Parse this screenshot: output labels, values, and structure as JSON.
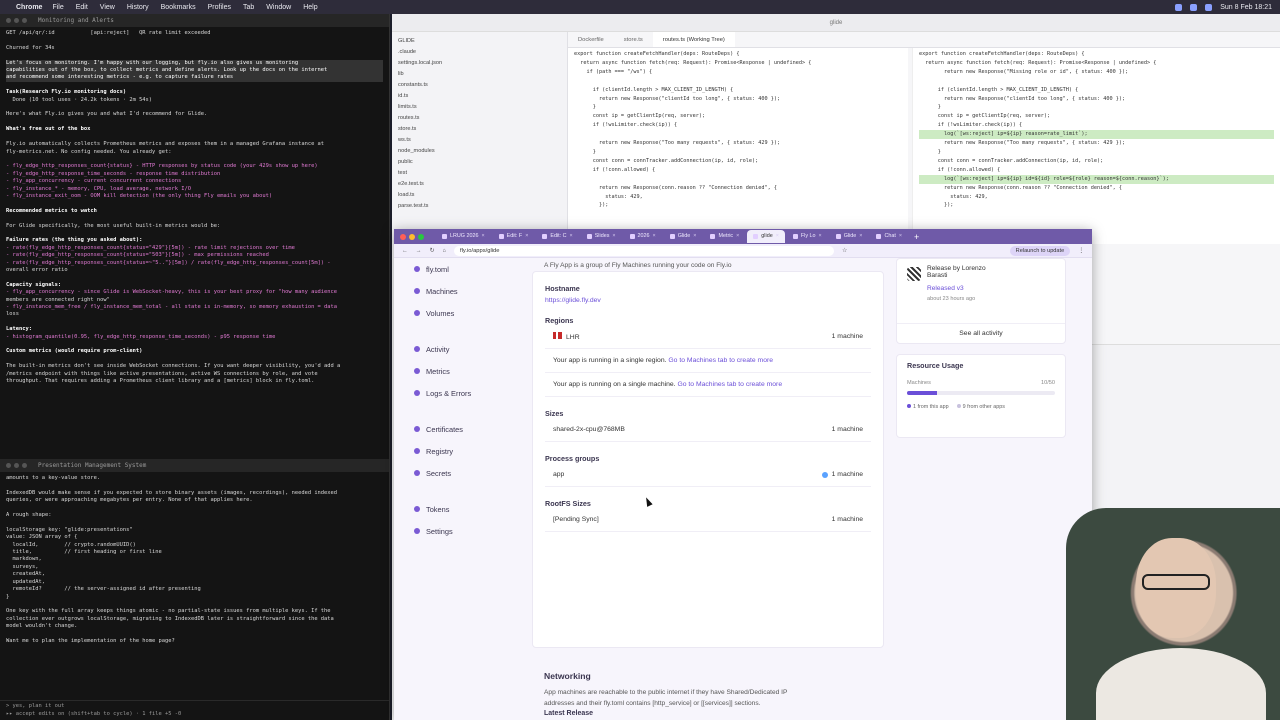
{
  "menubar": {
    "app": "Chrome",
    "items": [
      "File",
      "Edit",
      "View",
      "History",
      "Bookmarks",
      "Profiles",
      "Tab",
      "Window",
      "Help"
    ],
    "clock": "Sun 8 Feb 18:21"
  },
  "terminal_top": {
    "title": "Monitoring and Alerts",
    "lines": [
      "GET /api/qr/:id           [api:reject]   QR rate limit exceeded",
      "",
      "Churned for 34s",
      "",
      "Let's focus on monitoring. I'm happy with our logging, but fly.io also gives us monitoring",
      "capabilities out of the box, to collect metrics and define alerts. Look up the docs on the internet",
      "and recommend some interesting metrics - e.g. to capture failure rates",
      "",
      "Task(Research Fly.io monitoring docs)",
      "  Done (10 tool uses · 24.2k tokens · 2m 54s)",
      "",
      "Here's what Fly.io gives you and what I'd recommend for Glide.",
      "",
      "What's free out of the box",
      "",
      "Fly.io automatically collects Prometheus metrics and exposes them in a managed Grafana instance at",
      "fly-metrics.net. No config needed. You already get:",
      "",
      "- fly_edge_http_responses_count{status} - HTTP responses by status code (your 429s show up here)",
      "- fly_edge_http_response_time_seconds - response time distribution",
      "- fly_app_concurrency - current concurrent connections",
      "- fly_instance_* - memory, CPU, load average, network I/O",
      "- fly_instance_exit_oom - OOM kill detection (the only thing Fly emails you about)",
      "",
      "Recommended metrics to watch",
      "",
      "For Glide specifically, the most useful built-in metrics would be:",
      "",
      "Failure rates (the thing you asked about):",
      "- rate(fly_edge_http_responses_count{status=\"429\"}[5m]) - rate limit rejections over time",
      "- rate(fly_edge_http_responses_count{status=\"503\"}[5m]) - max permissions reached",
      "- rate(fly_edge_http_responses_count{status=~\"5..\"}[5m]) / rate(fly_edge_http_responses_count[5m]) -",
      "overall error ratio",
      "",
      "Capacity signals:",
      "- fly_app_concurrency - since Glide is WebSocket-heavy, this is your best proxy for \"how many audience",
      "members are connected right now\"",
      "- fly_instance_mem_free / fly_instance_mem_total - all state is in-memory, so memory exhaustion = data",
      "loss",
      "",
      "Latency:",
      "- histogram_quantile(0.95, fly_edge_http_response_time_seconds) - p95 response time",
      "",
      "Custom metrics (would require prom-client)",
      "",
      "The built-in metrics don't see inside WebSocket connections. If you want deeper visibility, you'd add a",
      "/metrics endpoint with things like active presentations, active WS connections by role, and vote",
      "throughput. That requires adding a Prometheus client library and a [metrics] block in fly.toml."
    ]
  },
  "terminal_bottom": {
    "title": "Presentation Management System",
    "lines": [
      "amounts to a key-value store.",
      "",
      "IndexedDB would make sense if you expected to store binary assets (images, recordings), needed indexed",
      "queries, or were approaching megabytes per entry. None of that applies here.",
      "",
      "A rough shape:",
      "",
      "localStorage key: \"glide:presentations\"",
      "value: JSON array of {",
      "  localId,        // crypto.randomUUID()",
      "  title,          // first heading or first line",
      "  markdown,",
      "  surveys,",
      "  createdAt,",
      "  updatedAt,",
      "  remoteId?       // the server-assigned id after presenting",
      "}",
      "",
      "One key with the full array keeps things atomic - no partial-state issues from multiple keys. If the",
      "collection ever outgrows localStorage, migrating to IndexedDB later is straightforward since the data",
      "model wouldn't change.",
      "",
      "Want me to plan the implementation of the home page?"
    ],
    "input": "> yes, plan it out",
    "footer": "▸▸ accept edits on (shift+tab to cycle) · 1 file +5 -0"
  },
  "vscode": {
    "title": "glide",
    "explorer": [
      "GLIDE",
      ".claude",
      "settings.local.json",
      "lib",
      "constants.ts",
      "id.ts",
      "limits.ts",
      "routes.ts",
      "store.ts",
      "ws.ts",
      "node_modules",
      "public",
      "test",
      "e2e.test.ts",
      "load.ts",
      "parse.test.ts"
    ],
    "tabs": [
      "Dockerfile",
      "store.ts",
      "routes.ts (Working Tree)"
    ],
    "left_code": [
      "export function createFetchHandler(deps: RouteDeps) {",
      "  return async function fetch(req: Request): Promise<Response | undefined> {",
      "    if (path === \"/ws\") {",
      "",
      "      if (clientId.length > MAX_CLIENT_ID_LENGTH) {",
      "        return new Response(\"clientId too long\", { status: 400 });",
      "      }",
      "      const ip = getClientIp(req, server);",
      "      if (!wsLimiter.check(ip)) {",
      "",
      "        return new Response(\"Too many requests\", { status: 429 });",
      "      }",
      "      const conn = connTracker.addConnection(ip, id, role);",
      "      if (!conn.allowed) {",
      "",
      "        return new Response(conn.reason ?? \"Connection denied\", {",
      "          status: 429,",
      "        });"
    ],
    "right_code": [
      "export function createFetchHandler(deps: RouteDeps) {",
      "  return async function fetch(req: Request): Promise<Response | undefined> {",
      "        return new Response(\"Missing role or id\", { status: 400 });",
      "",
      "      if (clientId.length > MAX_CLIENT_ID_LENGTH) {",
      "        return new Response(\"clientId too long\", { status: 400 });",
      "      }",
      "      const ip = getClientIp(req, server);",
      "      if (!wsLimiter.check(ip)) {",
      "        log(`[ws:reject] ip=${ip} reason=rate_limit`);",
      "        return new Response(\"Too many requests\", { status: 429 });",
      "      }",
      "      const conn = connTracker.addConnection(ip, id, role);",
      "      if (!conn.allowed) {",
      "        log(`[ws:reject] ip=${ip} id=${id} role=${role} reason=${conn.reason}`);",
      "        return new Response(conn.reason ?? \"Connection denied\", {",
      "          status: 429,",
      "        });"
    ]
  },
  "chrome": {
    "tabs": [
      "LRUG 2026",
      "Edit: F",
      "Edit: C",
      "Slides",
      "2026",
      "Glide",
      "Metric",
      "glide",
      "Fly Lo",
      "Glide",
      "Chat"
    ],
    "active_tab_index": 7,
    "url": "fly.io/apps/glide",
    "relaunch": "Relaunch to update"
  },
  "fly_sidebar": {
    "items": [
      {
        "label": "fly.toml",
        "icon": "file-icon"
      },
      {
        "label": "Machines",
        "icon": "machine-icon"
      },
      {
        "label": "Volumes",
        "icon": "volume-icon"
      },
      {
        "label": "Activity",
        "icon": "activity-icon"
      },
      {
        "label": "Metrics",
        "icon": "metrics-icon"
      },
      {
        "label": "Logs & Errors",
        "icon": "logs-icon"
      },
      {
        "label": "Certificates",
        "icon": "certificate-icon"
      },
      {
        "label": "Registry",
        "icon": "registry-icon"
      },
      {
        "label": "Secrets",
        "icon": "secrets-icon"
      },
      {
        "label": "Tokens",
        "icon": "tokens-icon"
      },
      {
        "label": "Settings",
        "icon": "settings-icon"
      }
    ]
  },
  "fly_main": {
    "description": "A Fly App is a group of Fly Machines running your code on Fly.io",
    "hostname_label": "Hostname",
    "hostname": "https://glide.fly.dev",
    "regions_label": "Regions",
    "region_code": "LHR",
    "region_count": "1 machine",
    "single_region": "Your app is running in a single region.",
    "single_region_link": "Go to Machines tab to create more",
    "single_machine": "Your app is running on a single machine.",
    "single_machine_link": "Go to Machines tab to create more",
    "sizes_label": "Sizes",
    "size": "shared-2x-cpu@768MB",
    "size_count": "1 machine",
    "process_label": "Process groups",
    "process": "app",
    "process_count": "1 machine",
    "rootfs_label": "RootFS Sizes",
    "rootfs": "[Pending Sync]",
    "rootfs_count": "1 machine",
    "networking_title": "Networking",
    "networking_text_1": "App machines are reachable to the public internet if they have Shared/Dedicated IP",
    "networking_text_2": "addresses and their fly.toml contains [http_service] or [[services]] sections.",
    "latest_release": "Latest Release"
  },
  "fly_right": {
    "release_title": "Release by Lorenzo",
    "release_author_2": "Barasti",
    "release_version": "Released v3",
    "release_time": "about 23 hours ago",
    "see_all": "See all activity",
    "usage_title": "Resource Usage",
    "usage_label": "Machines",
    "usage_value": "10/50",
    "usage_fraction": 0.2,
    "legend_this": "1 from this app",
    "legend_other": "9 from other apps"
  }
}
